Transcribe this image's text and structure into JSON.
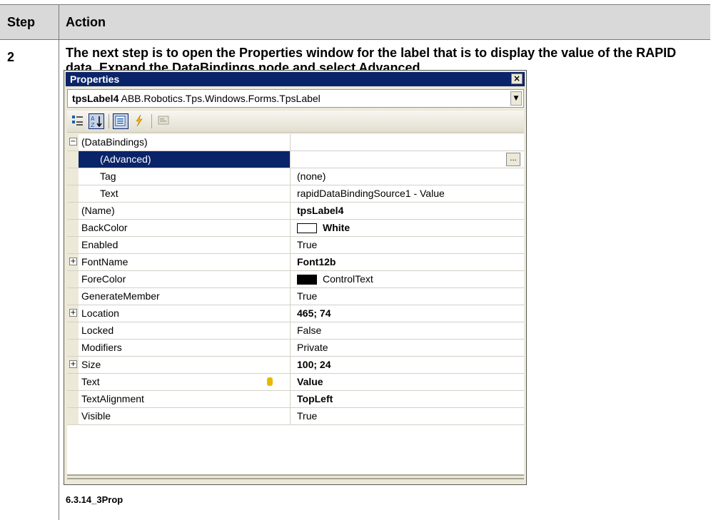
{
  "table": {
    "header_step": "Step",
    "header_action": "Action",
    "step_number": "2",
    "instruction_part1": "The next step is to open the ",
    "instruction_bold1": "Properties",
    "instruction_part2": " window for the label that is to display the value of the RAPID data. Expand the ",
    "instruction_bold2": "DataBindings",
    "instruction_part3": " node and select ",
    "instruction_bold3": "Advanced",
    "instruction_part4": ".",
    "caption": "6.3.14_3Prop"
  },
  "window": {
    "title": "Properties",
    "close_label": "×",
    "object_name": "tpsLabel4",
    "object_type": " ABB.Robotics.Tps.Windows.Forms.TpsLabel",
    "toolbar": {
      "categorized_icon": "categorized-icon",
      "alphabetical_icon": "alphabetical-icon",
      "properties_icon": "properties-icon",
      "events_icon": "events-icon",
      "property-pages_icon": "property-pages-icon"
    }
  },
  "properties": [
    {
      "name": "(DataBindings)",
      "value": "",
      "expander": "−"
    },
    {
      "name": "(Advanced)",
      "value": "",
      "selected": true,
      "ellipsis": "..."
    },
    {
      "name": "Tag",
      "value": "(none)"
    },
    {
      "name": "Text",
      "value": "rapidDataBindingSource1 - Value"
    },
    {
      "name": "(Name)",
      "value": "tpsLabel4",
      "bold": true
    },
    {
      "name": "BackColor",
      "value": "White",
      "bold": true,
      "swatch": "#ffffff"
    },
    {
      "name": "Enabled",
      "value": "True"
    },
    {
      "name": "FontName",
      "value": "Font12b",
      "bold": true,
      "expander": "+"
    },
    {
      "name": "ForeColor",
      "value": "ControlText",
      "swatch": "#000000"
    },
    {
      "name": "GenerateMember",
      "value": "True"
    },
    {
      "name": "Location",
      "value": "465; 74",
      "bold": true,
      "expander": "+"
    },
    {
      "name": "Locked",
      "value": "False"
    },
    {
      "name": "Modifiers",
      "value": "Private"
    },
    {
      "name": "Size",
      "value": "100; 24",
      "bold": true,
      "expander": "+"
    },
    {
      "name": "Text",
      "value": "Value",
      "bold": true,
      "db_icon": true
    },
    {
      "name": "TextAlignment",
      "value": "TopLeft",
      "bold": true
    },
    {
      "name": "Visible",
      "value": "True"
    }
  ]
}
